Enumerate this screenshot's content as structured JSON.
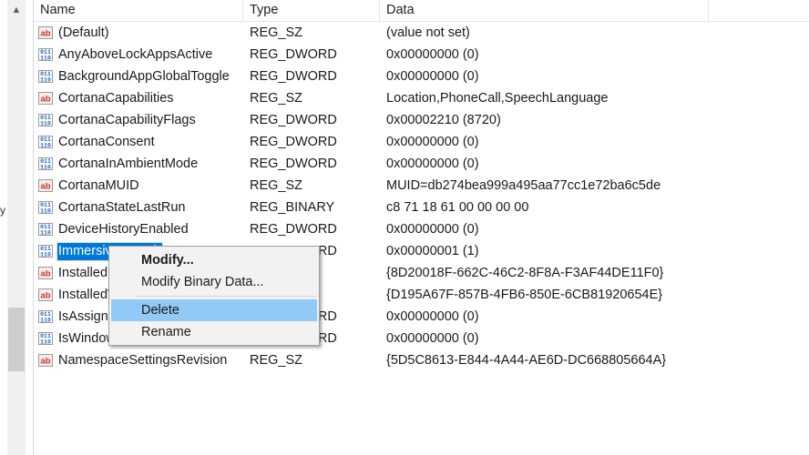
{
  "header": {
    "name": "Name",
    "type": "Type",
    "data": "Data"
  },
  "left_stub": "y",
  "rows": [
    {
      "name": "(Default)",
      "type": "REG_SZ",
      "data": "(value not set)",
      "icon": "string-value-icon"
    },
    {
      "name": "AnyAboveLockAppsActive",
      "type": "REG_DWORD",
      "data": "0x00000000 (0)",
      "icon": "binary-value-icon"
    },
    {
      "name": "BackgroundAppGlobalToggle",
      "type": "REG_DWORD",
      "data": "0x00000000 (0)",
      "icon": "binary-value-icon"
    },
    {
      "name": "CortanaCapabilities",
      "type": "REG_SZ",
      "data": "Location,PhoneCall,SpeechLanguage",
      "icon": "string-value-icon"
    },
    {
      "name": "CortanaCapabilityFlags",
      "type": "REG_DWORD",
      "data": "0x00002210 (8720)",
      "icon": "binary-value-icon"
    },
    {
      "name": "CortanaConsent",
      "type": "REG_DWORD",
      "data": "0x00000000 (0)",
      "icon": "binary-value-icon"
    },
    {
      "name": "CortanaInAmbientMode",
      "type": "REG_DWORD",
      "data": "0x00000000 (0)",
      "icon": "binary-value-icon"
    },
    {
      "name": "CortanaMUID",
      "type": "REG_SZ",
      "data": "MUID=db274bea999a495aa77cc1e72ba6c5de",
      "icon": "string-value-icon"
    },
    {
      "name": "CortanaStateLastRun",
      "type": "REG_BINARY",
      "data": "c8 71 18 61 00 00 00 00",
      "icon": "binary-value-icon"
    },
    {
      "name": "DeviceHistoryEnabled",
      "type": "REG_DWORD",
      "data": "0x00000000 (0)",
      "icon": "binary-value-icon"
    },
    {
      "name": "ImmersiveSearch",
      "type": "REG_DWORD",
      "data": "0x00000001 (1)",
      "icon": "binary-value-icon",
      "selected": true
    },
    {
      "name": "InstalledPackage",
      "type": "REG_SZ",
      "data": "{8D20018F-662C-46C2-8F8A-F3AF44DE11F0}",
      "icon": "string-value-icon"
    },
    {
      "name": "InstalledWin32AppsRevision",
      "type": "REG_SZ",
      "data": "{D195A67F-857B-4FB6-850E-6CB81920654E}",
      "icon": "string-value-icon"
    },
    {
      "name": "IsAssignedAccess",
      "type": "REG_DWORD",
      "data": "0x00000000 (0)",
      "icon": "binary-value-icon"
    },
    {
      "name": "IsWindowsHelloActive",
      "type": "REG_DWORD",
      "data": "0x00000000 (0)",
      "icon": "binary-value-icon"
    },
    {
      "name": "NamespaceSettingsRevision",
      "type": "REG_SZ",
      "data": "{5D5C8613-E844-4A44-AE6D-DC668805664A}",
      "icon": "string-value-icon"
    }
  ],
  "context_menu": {
    "items": [
      {
        "label": "Modify...",
        "bold": true
      },
      {
        "label": "Modify Binary Data..."
      },
      {
        "label": "Delete",
        "hover": true
      },
      {
        "label": "Rename"
      }
    ]
  }
}
